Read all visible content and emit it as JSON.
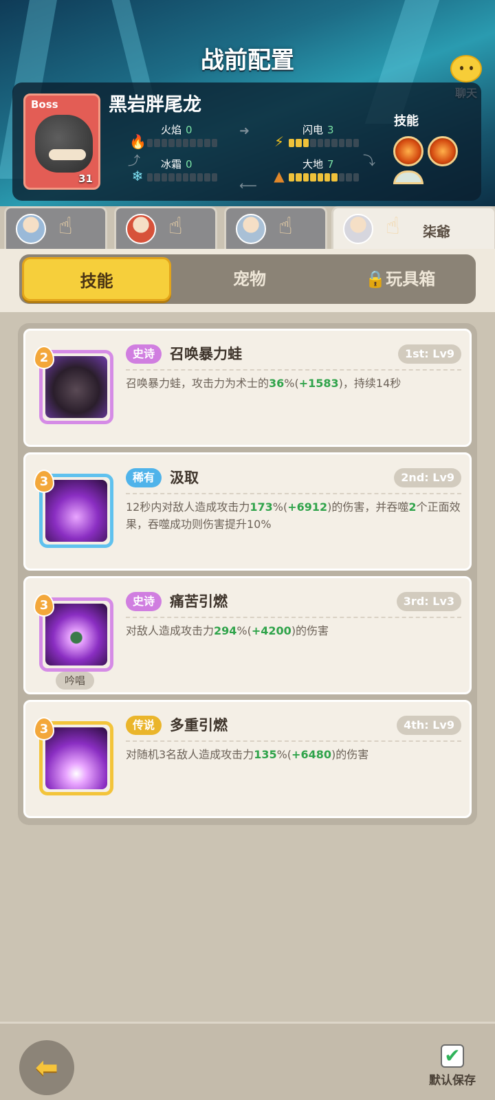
{
  "header": {
    "title": "战前配置",
    "chat_label": "聊天"
  },
  "boss": {
    "badge": "Boss",
    "name": "黑岩胖尾龙",
    "level": "31",
    "stats": [
      {
        "label": "火焰",
        "value": "0",
        "icon": "fire-icon",
        "level": 0
      },
      {
        "label": "闪电",
        "value": "3",
        "icon": "lightning-icon",
        "level": 3
      },
      {
        "label": "冰霜",
        "value": "0",
        "icon": "snowflake-icon",
        "level": 0
      },
      {
        "label": "大地",
        "value": "7",
        "icon": "earth-icon",
        "level": 7
      }
    ],
    "skills_label": "技能"
  },
  "hero_tabs": [
    {
      "avatar": "hero-avatar-blue-hair",
      "active": false
    },
    {
      "avatar": "hero-avatar-red-hair",
      "active": false
    },
    {
      "avatar": "hero-avatar-silver-hair",
      "active": false
    },
    {
      "avatar": "hero-avatar-white-hair",
      "active": true,
      "name": "柒爺"
    }
  ],
  "segments": {
    "skills": "技能",
    "pets": "宠物",
    "toybox": "玩具箱"
  },
  "cards": [
    {
      "cost": "2",
      "rarity": "史诗",
      "rarity_color": "#d07ee0",
      "name": "召唤暴力蛙",
      "slot": "1st: Lv9",
      "desc_parts": [
        "召唤暴力蛙，攻击力为术士的",
        "36",
        "%(",
        "+1583",
        ")，持续14秒"
      ]
    },
    {
      "cost": "3",
      "rarity": "稀有",
      "rarity_color": "#4fb3ea",
      "name": "汲取",
      "slot": "2nd: Lv9",
      "desc_parts": [
        "12秒内对敌人造成攻击力",
        "173",
        "%(",
        "+6912",
        ")的伤害，并吞噬",
        "2",
        "个正面效果，吞噬成功则伤害提升10%"
      ]
    },
    {
      "cost": "3",
      "rarity": "史诗",
      "rarity_color": "#d07ee0",
      "name": "痛苦引燃",
      "slot": "3rd: Lv3",
      "chant": "吟唱",
      "desc_parts": [
        "对敌人造成攻击力",
        "294",
        "%(",
        "+4200",
        ")的伤害"
      ]
    },
    {
      "cost": "3",
      "rarity": "传说",
      "rarity_color": "#eab52b",
      "name": "多重引燃",
      "slot": "4th: Lv9",
      "desc_parts": [
        "对随机3名敌人造成攻击力",
        "135",
        "%(",
        "+6480",
        ")的伤害"
      ]
    }
  ],
  "footer": {
    "save_label": "默认保存"
  }
}
